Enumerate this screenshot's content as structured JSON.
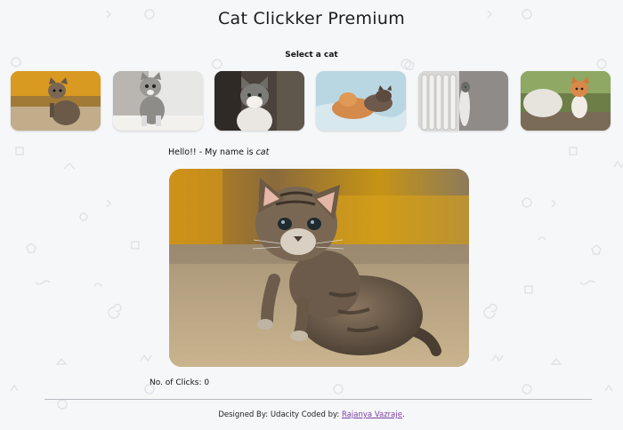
{
  "app": {
    "title": "Cat Clickker Premium"
  },
  "selector": {
    "label": "Select a cat"
  },
  "thumbnails": [
    {
      "alt": "tabby kitten on carpet"
    },
    {
      "alt": "silver tabby kitten"
    },
    {
      "alt": "grey and white cat"
    },
    {
      "alt": "two sleeping kittens"
    },
    {
      "alt": "cat behind radiator"
    },
    {
      "alt": "orange and white kitten"
    }
  ],
  "greeting": {
    "prefix": "Hello!! - My name is ",
    "name": "cat"
  },
  "main_image": {
    "alt": "tabby kitten sitting on carpet"
  },
  "clicks": {
    "label": "No. of Clicks:",
    "value": "0"
  },
  "footer": {
    "designed_by": "Designed By: Udacity Coded by:",
    "author": "Rajanya Vazraje",
    "suffix": "."
  },
  "colors": {
    "background": "#f6f7f9",
    "link": "#7b3fa0",
    "divider": "#b9bcc2"
  }
}
